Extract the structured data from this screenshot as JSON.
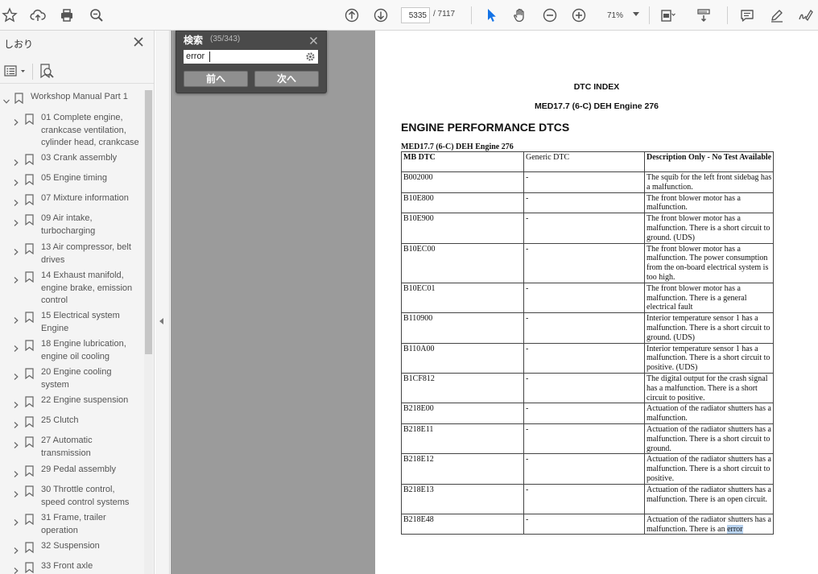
{
  "toolbar": {
    "page_current": "5335",
    "page_total": "/ 7117",
    "zoom": "71%"
  },
  "sidebar": {
    "title": "しおり",
    "items": [
      {
        "label": "Workshop Manual Part 1"
      },
      {
        "label": "01 Complete engine,\ncrankcase ventilation,\ncylinder head, crankcase"
      },
      {
        "label": "03 Crank assembly"
      },
      {
        "label": "05 Engine timing"
      },
      {
        "label": "07 Mixture information"
      },
      {
        "label": "09 Air intake,\nturbocharging"
      },
      {
        "label": "13 Air compressor, belt\ndrives"
      },
      {
        "label": "14 Exhaust manifold,\nengine brake, emission\ncontrol"
      },
      {
        "label": "15 Electrical system\nEngine"
      },
      {
        "label": "18 Engine lubrication,\nengine oil cooling"
      },
      {
        "label": "20 Engine cooling\nsystem"
      },
      {
        "label": "22 Engine suspension"
      },
      {
        "label": "25 Clutch"
      },
      {
        "label": "27 Automatic\ntransmission"
      },
      {
        "label": "29 Pedal assembly"
      },
      {
        "label": "30 Throttle control,\nspeed control systems"
      },
      {
        "label": "31 Frame, trailer\noperation"
      },
      {
        "label": "32 Suspension"
      },
      {
        "label": "33 Front axle"
      }
    ]
  },
  "search": {
    "title": "検索",
    "count": "(35/343)",
    "query": "error",
    "prev_label": "前へ",
    "next_label": "次へ"
  },
  "document": {
    "heading1": "DTC INDEX",
    "heading2": "MED17.7 (6-C) DEH Engine 276",
    "heading3": "ENGINE PERFORMANCE DTCS",
    "table_caption": "MED17.7 (6-C) DEH Engine 276",
    "columns": [
      "MB DTC",
      "Generic DTC",
      "Description Only - No Test Available"
    ],
    "rows": [
      {
        "mb": "B002000",
        "gen": "-",
        "desc": "The squib for the left front sidebag has a malfunction."
      },
      {
        "mb": "B10E800",
        "gen": "-",
        "desc": "The front blower motor has a malfunction."
      },
      {
        "mb": "B10E900",
        "gen": "-",
        "desc": "The front blower motor has a malfunction. There is a short circuit to ground. (UDS)"
      },
      {
        "mb": "B10EC00",
        "gen": "-",
        "desc": "The front blower motor has a malfunction. The power consumption from the on-board electrical system is too high."
      },
      {
        "mb": "B10EC01",
        "gen": "-",
        "desc": "The front blower motor has a malfunction. There is a general electrical fault"
      },
      {
        "mb": "B110900",
        "gen": "-",
        "desc": "Interior temperature sensor 1 has a malfunction. There is a short circuit to ground. (UDS)"
      },
      {
        "mb": "B110A00",
        "gen": "-",
        "desc": "Interior temperature sensor 1 has a malfunction. There is a short circuit to positive. (UDS)"
      },
      {
        "mb": "B1CF812",
        "gen": "-",
        "desc": "The digital output for the crash signal has a malfunction. There is a short circuit to positive."
      },
      {
        "mb": "B218E00",
        "gen": "-",
        "desc": "Actuation of the radiator shutters has a malfunction."
      },
      {
        "mb": "B218E11",
        "gen": "-",
        "desc": "Actuation of the radiator shutters has a malfunction. There is a short circuit to ground."
      },
      {
        "mb": "B218E12",
        "gen": "-",
        "desc": "Actuation of the radiator shutters has a malfunction. There is a short circuit to positive."
      },
      {
        "mb": "B218E13",
        "gen": "-",
        "desc": "Actuation of the radiator shutters has a malfunction. There is an open circuit."
      },
      {
        "mb": "B218E48",
        "gen": "-",
        "desc": "Actuation of the radiator shutters has a malfunction. There is an",
        "desc_hl": "error"
      }
    ]
  }
}
